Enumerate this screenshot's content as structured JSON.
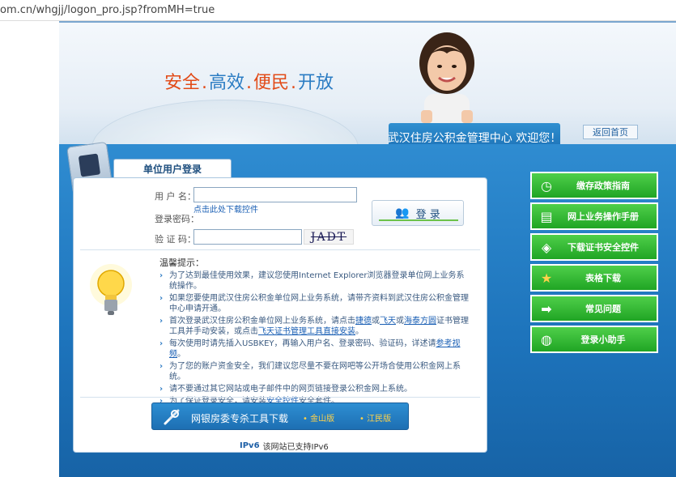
{
  "browser": {
    "url": "om.cn/whgjj/logon_pro.jsp?fromMH=true"
  },
  "header": {
    "slogan": [
      "安全",
      "高效",
      "便民",
      "开放"
    ],
    "welcome": "武汉住房公积金管理中心 欢迎您！",
    "home_link": "返回首页"
  },
  "login": {
    "tab_label": "单位用户登录",
    "username_label": "用 户 名：",
    "username_value": "",
    "download_link": "点击此处下载控件",
    "password_label": "登录密码：",
    "captcha_label": "验 证 码：",
    "captcha_value": "",
    "captcha_text": "JADT",
    "login_button": "登 录"
  },
  "tips": {
    "title": "温馨提示：",
    "items": [
      {
        "text": "为了达到最佳使用效果，建议您使用Internet Explorer浏览器登录单位网上业务系统操作。"
      },
      {
        "text": "如果您要使用武汉住房公积金单位网上业务系统，请带齐资料到武汉住房公积金管理中心申请开通。"
      },
      {
        "pre": "首次登录武汉住房公积金单位网上业务系统，请点击",
        "l1": "捷德",
        "m1": "或",
        "l2": "飞天",
        "m2": "或",
        "l3": "海泰方圆",
        "m3": "证书管理工具并手动安装，或点击",
        "l4": "飞天证书管理工具直接安装",
        "post": "。"
      },
      {
        "pre": "每次使用时请先插入USBKEY，再输入用户名、登录密码、验证码，详述请",
        "link": "参考视频",
        "post": "。"
      },
      {
        "text": "为了您的账户资金安全，我们建议您尽量不要在网吧等公开场合使用公积金网上系统。"
      },
      {
        "text": "请不要通过其它网站或电子邮件中的网页链接登录公积金网上系统。"
      },
      {
        "pre": "为了保证登录安全，请安装",
        "link": "安全控件",
        "post": "安全套件。"
      }
    ]
  },
  "tools": {
    "label": "网银房委专杀工具下载",
    "v1": "金山版",
    "v2": "江民版"
  },
  "ipv6": {
    "logo": "IPv6",
    "text": "该网站已支持IPv6"
  },
  "side_menu": [
    {
      "label": "缴存政策指南",
      "icon": "clock-icon",
      "glyph": "◷"
    },
    {
      "label": "网上业务操作手册",
      "icon": "manual-icon",
      "glyph": "▤"
    },
    {
      "label": "下载证书安全控件",
      "icon": "shield-icon",
      "glyph": "◈"
    },
    {
      "label": "表格下载",
      "icon": "star-icon",
      "glyph": "★"
    },
    {
      "label": "常见问题",
      "icon": "arrow-icon",
      "glyph": "➡"
    },
    {
      "label": "登录小助手",
      "icon": "android-icon",
      "glyph": "◍"
    }
  ],
  "colors": {
    "accent_red": "#e24b18",
    "accent_blue": "#2b7cc3",
    "main_blue": "#1d73bb",
    "side_green": "#20a524"
  }
}
